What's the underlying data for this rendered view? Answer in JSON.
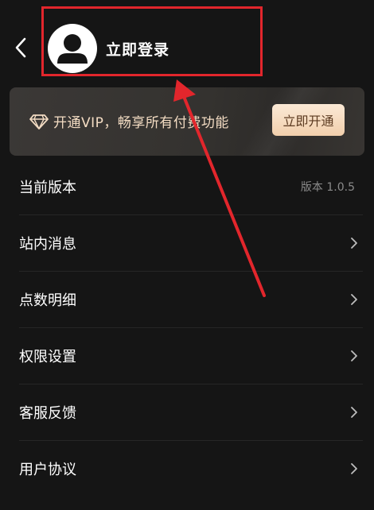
{
  "header": {
    "login_label": "立即登录",
    "icons": {
      "back": "back-icon",
      "avatar": "user-avatar-icon"
    }
  },
  "vip_banner": {
    "text": "开通VIP，畅享所有付费功能",
    "button_label": "立即开通",
    "icon": "diamond-icon",
    "colors": {
      "text": "#f3dcc3",
      "button_bg": "#f1cfac",
      "button_text": "#5b3a20"
    }
  },
  "menu": {
    "items": [
      {
        "label": "当前版本",
        "value": "版本 1.0.5"
      },
      {
        "label": "站内消息"
      },
      {
        "label": "点数明细"
      },
      {
        "label": "权限设置"
      },
      {
        "label": "客服反馈"
      },
      {
        "label": "用户协议"
      }
    ]
  },
  "annotation": {
    "color": "#e2262c"
  },
  "theme": {
    "background": "#151515",
    "divider": "#262626"
  }
}
